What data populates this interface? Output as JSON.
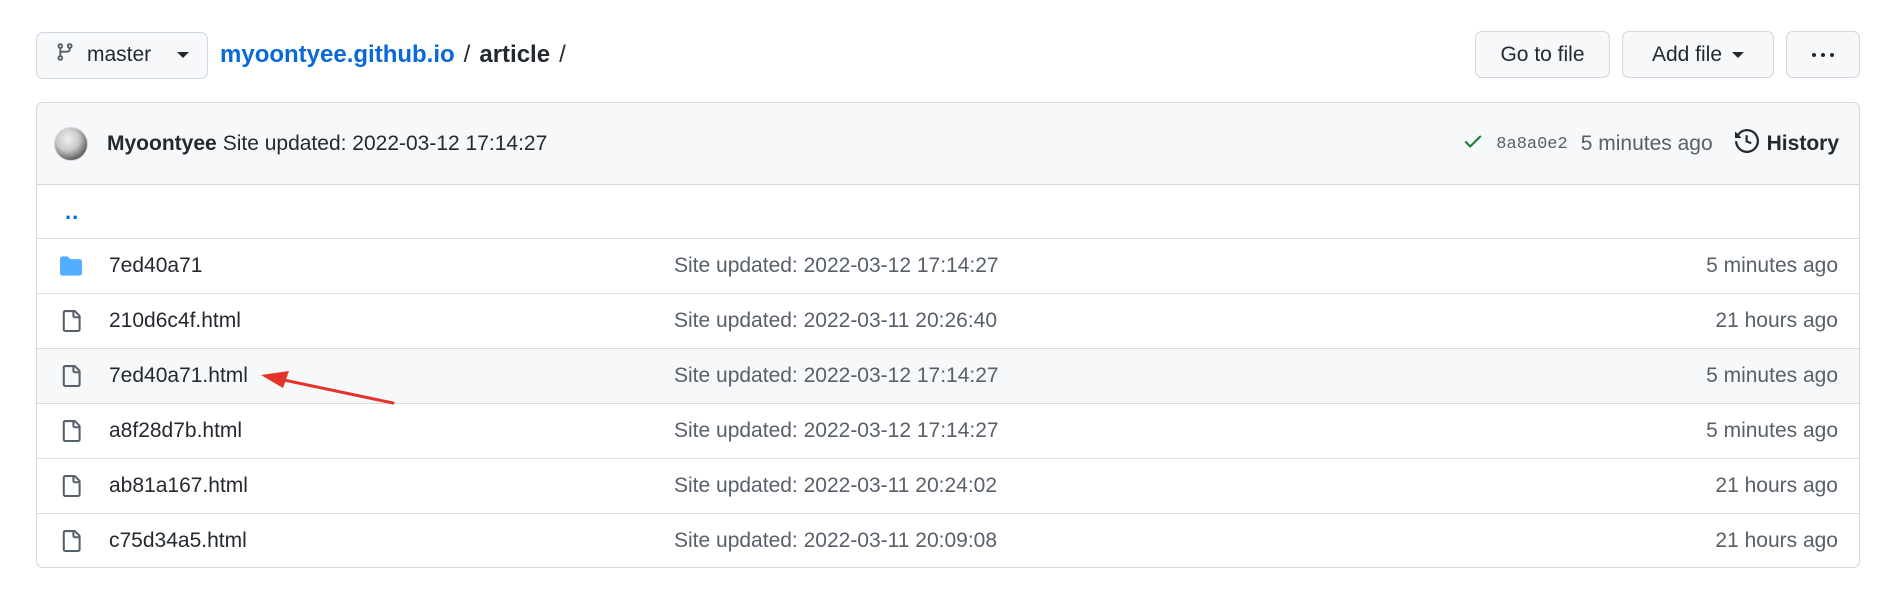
{
  "toolbar": {
    "branch_label": "master",
    "breadcrumb": {
      "repo": "myoontyee.github.io",
      "sep1": "/",
      "folder": "article",
      "sep2": "/"
    },
    "go_to_file_label": "Go to file",
    "add_file_label": "Add file",
    "more_icon": "kebab-horizontal-icon"
  },
  "commit": {
    "author": "Myoontyee",
    "message": "Site updated: 2022-03-12 17:14:27",
    "status": "success",
    "sha": "8a8a0e2",
    "time": "5 minutes ago",
    "history_label": "History"
  },
  "files": {
    "parent_dir": "..",
    "rows": [
      {
        "type": "folder",
        "name": "7ed40a71",
        "message": "Site updated: 2022-03-12 17:14:27",
        "time": "5 minutes ago"
      },
      {
        "type": "file",
        "name": "210d6c4f.html",
        "message": "Site updated: 2022-03-11 20:26:40",
        "time": "21 hours ago"
      },
      {
        "type": "file",
        "name": "7ed40a71.html",
        "message": "Site updated: 2022-03-12 17:14:27",
        "time": "5 minutes ago"
      },
      {
        "type": "file",
        "name": "a8f28d7b.html",
        "message": "Site updated: 2022-03-12 17:14:27",
        "time": "5 minutes ago"
      },
      {
        "type": "file",
        "name": "ab81a167.html",
        "message": "Site updated: 2022-03-11 20:24:02",
        "time": "21 hours ago"
      },
      {
        "type": "file",
        "name": "c75d34a5.html",
        "message": "Site updated: 2022-03-11 20:09:08",
        "time": "21 hours ago"
      }
    ]
  },
  "colors": {
    "link": "#0969da",
    "folder_icon": "#54aeff",
    "success_check": "#1a7f37",
    "annotation_arrow": "#e5332a"
  }
}
